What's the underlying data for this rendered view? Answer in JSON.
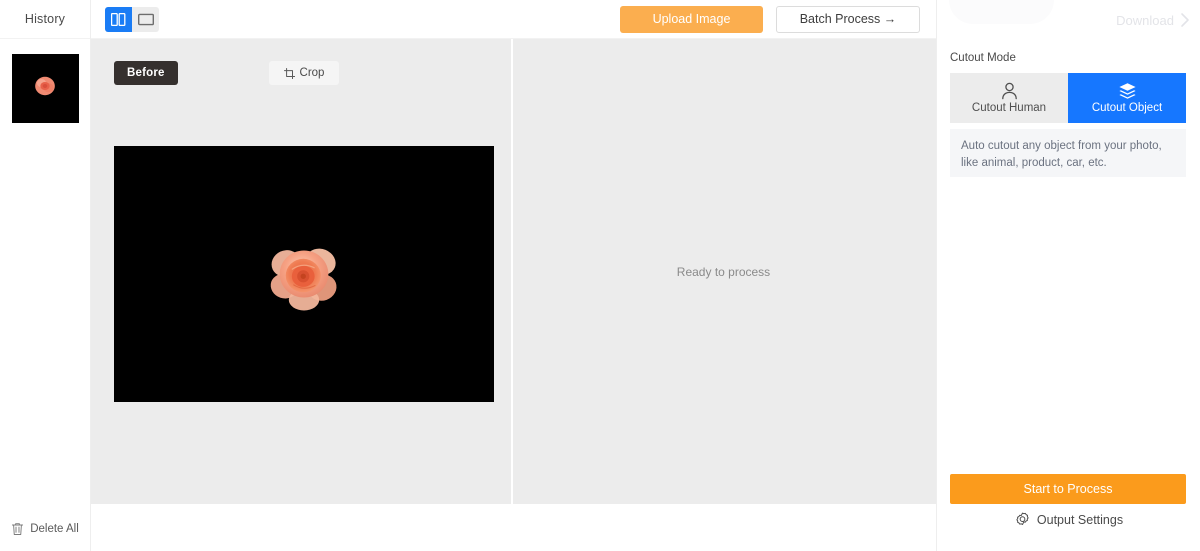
{
  "sidebar": {
    "header_label": "History",
    "thumbnail": {
      "name": "rose-thumbnail",
      "background_color": "#000000"
    },
    "delete_all_label": "Delete All",
    "delete_all_icon": "trash-icon"
  },
  "topbar": {
    "view_toggle": {
      "split_icon": "split-view-icon",
      "split_selected": true,
      "split_color": "#1a7cf5",
      "single_icon": "single-view-icon",
      "single_selected": false,
      "single_color": "#ececec"
    },
    "upload_label": "Upload Image",
    "upload_color": "#fbae4f",
    "batch_label": "Batch Process →"
  },
  "canvas": {
    "before_badge": "Before",
    "crop_label": "Crop",
    "crop_icon": "crop-icon",
    "image": {
      "name": "rose-preview",
      "background_color": "#000000"
    },
    "ready_text": "Ready to process"
  },
  "right_panel": {
    "download_label": "Download",
    "download_icon": "chevron-right-icon",
    "download_disabled": true,
    "section_label": "Cutout Mode",
    "modes": [
      {
        "label": "Cutout Human",
        "icon": "person-icon",
        "selected": false,
        "color": "#ececec"
      },
      {
        "label": "Cutout Object",
        "icon": "layers-icon",
        "selected": true,
        "color": "#1677ff"
      }
    ],
    "mode_description": "Auto cutout any object from your photo, like animal, product, car, etc.",
    "start_label": "Start to Process",
    "start_color": "#fb9b1c",
    "output_settings_label": "Output Settings",
    "output_settings_icon": "gear-icon"
  }
}
